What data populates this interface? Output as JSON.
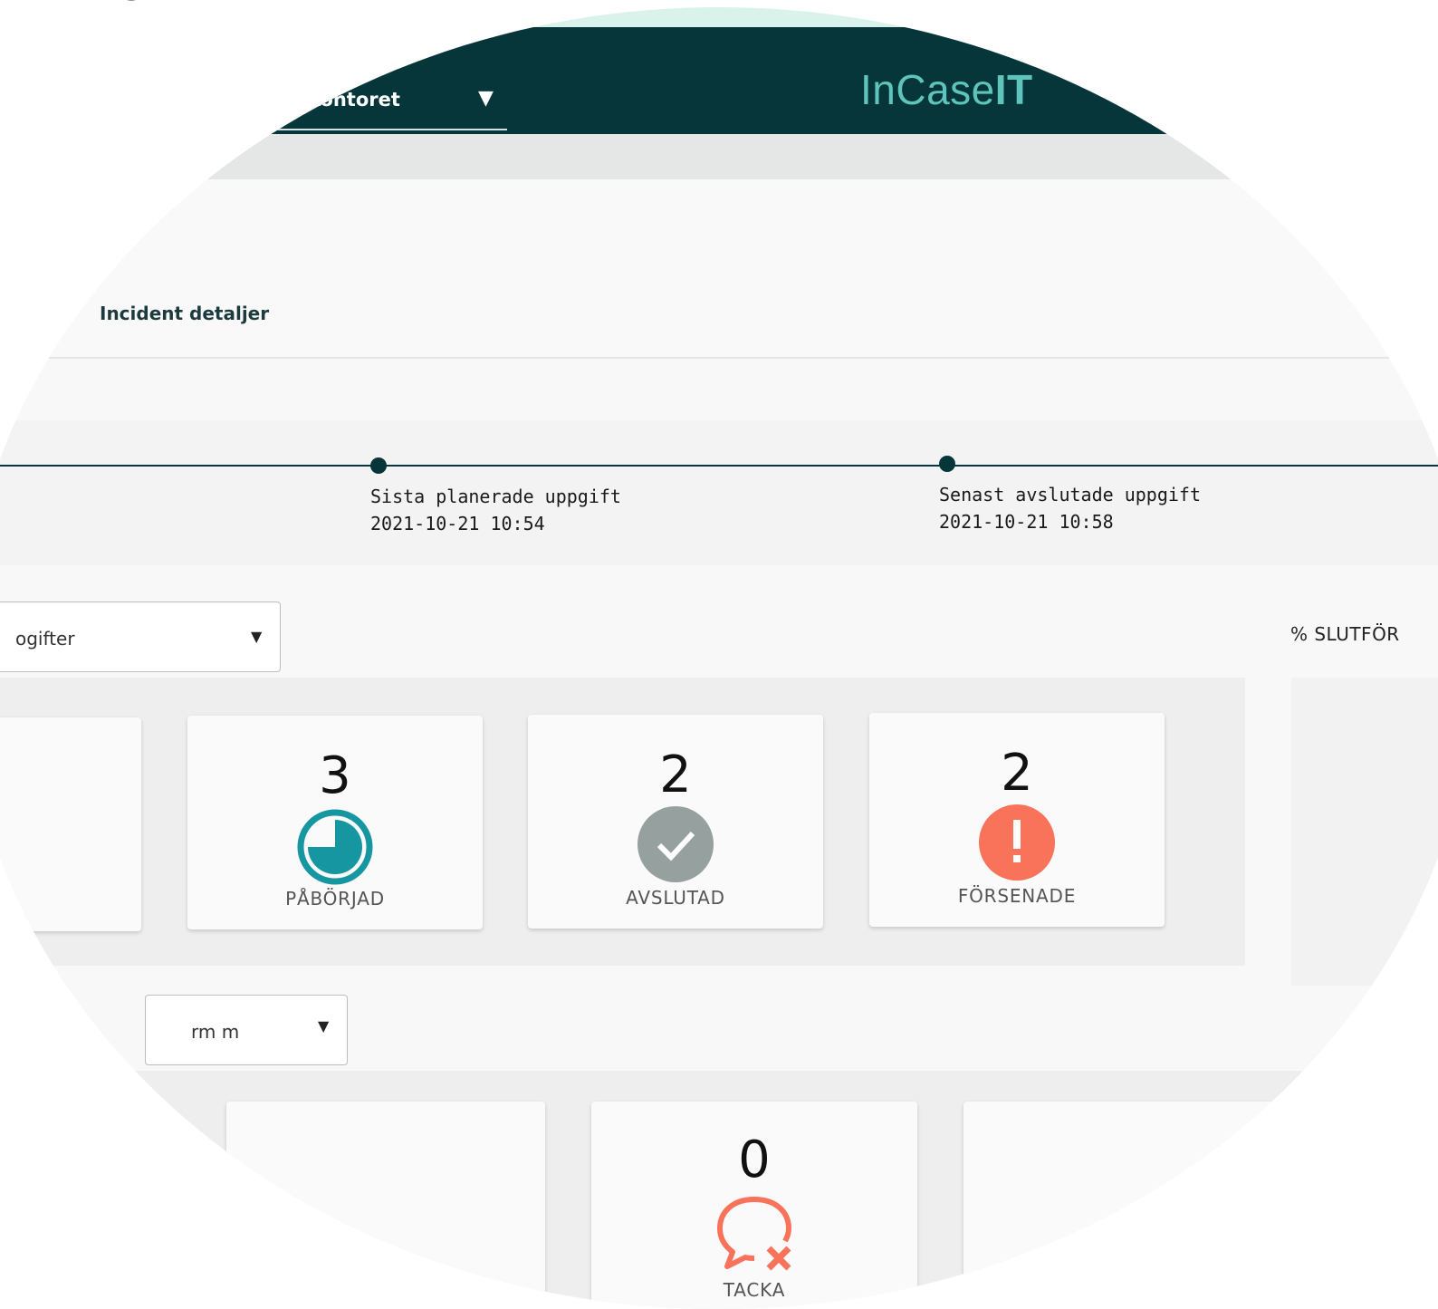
{
  "header": {
    "org_select_value": "kontoret",
    "brand_light": "InCase",
    "brand_bold": "IT"
  },
  "page": {
    "title": "Incident detaljer"
  },
  "timeline": {
    "events": [
      {
        "label": "Sista planerade uppgift",
        "time": "2021-10-21 10:54"
      },
      {
        "label": "Senast avslutade uppgift",
        "time": "2021-10-21 10:58"
      }
    ]
  },
  "filters": {
    "task_select_value": "ogifter",
    "group_select_value": "rm m"
  },
  "progress": {
    "label": "% SLUTFÖR"
  },
  "status_cards": [
    {
      "count": "3",
      "label": "PÅBÖRJAD",
      "icon": "in-progress-clock-icon",
      "color": "#1596a0"
    },
    {
      "count": "2",
      "label": "AVSLUTAD",
      "icon": "check-icon",
      "color": "#95a09f"
    },
    {
      "count": "2",
      "label": "FÖRSENADE",
      "icon": "exclamation-icon",
      "color": "#f8735a"
    }
  ],
  "response_cards": [
    {
      "count": "0",
      "label": "TACKA",
      "icon": "declined-chat-icon",
      "color": "#f8735a"
    }
  ]
}
